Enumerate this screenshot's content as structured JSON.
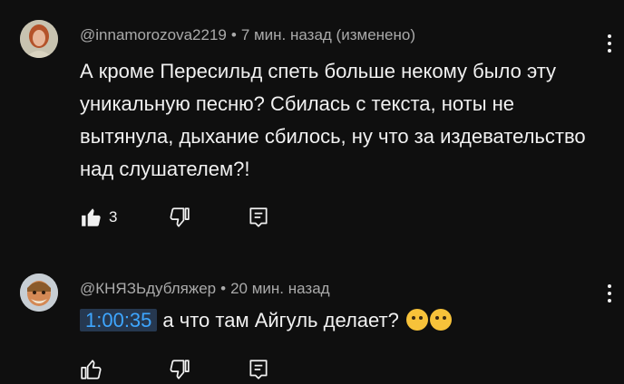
{
  "comments": [
    {
      "author": "@innamorozova2219",
      "time": "7 мин. назад (изменено)",
      "text": "А кроме Пересильд спеть больше некому было эту уникальную песню? Сбилась с текста, ноты не вытянула, дыхание сбилось, ну что за издевательство над слушателем?!",
      "likes": "3",
      "liked": true
    },
    {
      "author": "@КНЯЗЬдубляжер",
      "time": "20 мин. назад",
      "timestamp": "1:00:35",
      "text": "а что там Айгуль делает?",
      "emoji": [
        "thinking-face-raised-eyebrow",
        "thinking-face-raised-eyebrow"
      ],
      "likes": "",
      "liked": false
    }
  ],
  "colors": {
    "background": "#0f0f0f",
    "text": "#f1f1f1",
    "meta": "#aaaaaa",
    "timestamp_bg": "#263850",
    "timestamp_text": "#3ea6ff"
  },
  "icons": {
    "like": "thumb-up-icon",
    "dislike": "thumb-down-icon",
    "reply": "reply-icon",
    "more": "more-vert-icon"
  }
}
